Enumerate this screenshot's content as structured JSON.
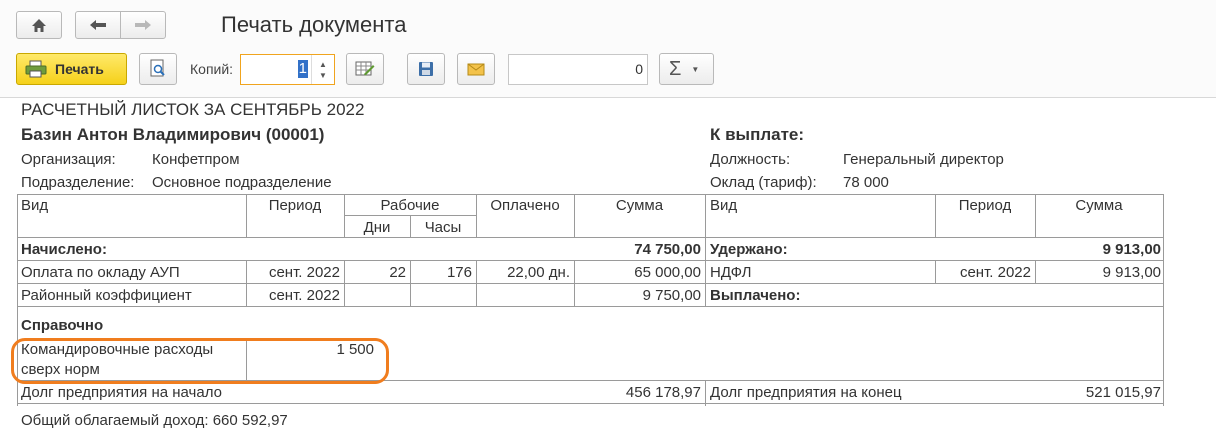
{
  "window": {
    "title": "Печать документа"
  },
  "toolbar": {
    "print_label": "Печать",
    "copies_label": "Копий:",
    "copies_value": "1",
    "number_value": "0",
    "icons": [
      "home-icon",
      "back-arrow-icon",
      "forward-arrow-icon",
      "printer-icon",
      "preview-icon",
      "table-settings-icon",
      "save-icon",
      "mail-icon",
      "sigma-icon"
    ]
  },
  "payslip": {
    "title": "РАСЧЕТНЫЙ ЛИСТОК ЗА СЕНТЯБРЬ 2022",
    "employee": "Базин Антон Владимирович (00001)",
    "to_pay_label": "К выплате:",
    "org_label": "Организация:",
    "org_value": "Конфетпром",
    "dept_label": "Подразделение:",
    "dept_value": "Основное подразделение",
    "position_label": "Должность:",
    "position_value": "Генеральный директор",
    "salary_label": "Оклад (тариф):",
    "salary_value": "78 000",
    "headers": {
      "kind": "Вид",
      "period": "Период",
      "working": "Рабочие",
      "days": "Дни",
      "hours": "Часы",
      "paid": "Оплачено",
      "sum": "Сумма",
      "kind_r": "Вид",
      "period_r": "Период",
      "sum_r": "Сумма"
    },
    "accrued_label": "Начислено:",
    "accrued_total": "74 750,00",
    "withheld_label": "Удержано:",
    "withheld_total": "9 913,00",
    "rows": [
      {
        "kind": "Оплата по окладу АУП",
        "period": "сент. 2022",
        "days": "22",
        "hours": "176",
        "paid": "22,00 дн.",
        "sum": "65 000,00"
      },
      {
        "kind": "Районный коэффициент",
        "period": "сент. 2022",
        "days": "",
        "hours": "",
        "paid": "",
        "sum": "9 750,00"
      }
    ],
    "withheld_rows": [
      {
        "kind": "НДФЛ",
        "period": "сент. 2022",
        "sum": "9 913,00"
      }
    ],
    "paid_out_label": "Выплачено:",
    "reference_label": "Справочно",
    "reference_item_line1": "Командировочные расходы",
    "reference_item_line2": "сверх норм",
    "reference_item_value": "1 500",
    "debt_start_label": "Долг предприятия на начало",
    "debt_start_value": "456 178,97",
    "debt_end_label": "Долг предприятия на конец",
    "debt_end_value": "521 015,97",
    "taxable_income": "Общий облагаемый доход: 660 592,97"
  }
}
